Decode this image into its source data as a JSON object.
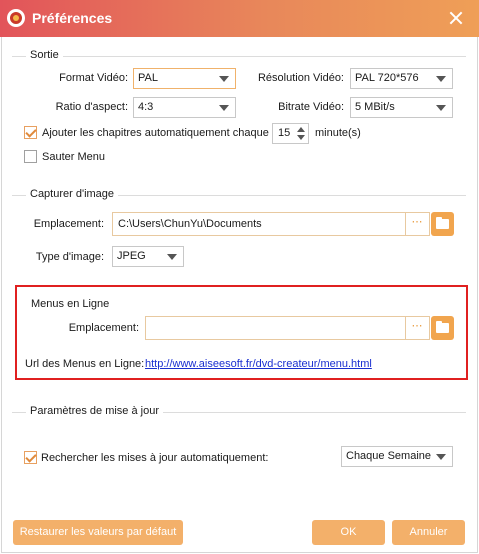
{
  "window": {
    "title": "Préférences"
  },
  "sortie": {
    "group_title": "Sortie",
    "format_video_label": "Format Vidéo:",
    "format_video_value": "PAL",
    "resolution_label": "Résolution Vidéo:",
    "resolution_value": "PAL 720*576",
    "ratio_label": "Ratio d'aspect:",
    "ratio_value": "4:3",
    "bitrate_label": "Bitrate Vidéo:",
    "bitrate_value": "5 MBit/s",
    "chapters_label": "Ajouter les chapitres automatiquement chaque",
    "chapters_checked": true,
    "chapters_value": "15",
    "chapters_unit": "minute(s)",
    "skip_menu_label": "Sauter Menu",
    "skip_menu_checked": false
  },
  "capture": {
    "group_title": "Capturer d'image",
    "location_label": "Emplacement:",
    "location_value": "C:\\Users\\ChunYu\\Documents",
    "image_type_label": "Type d'image:",
    "image_type_value": "JPEG"
  },
  "online_menus": {
    "group_title": "Menus en Ligne",
    "location_label": "Emplacement:",
    "location_value": "",
    "url_label": "Url des Menus en Ligne:",
    "url_value": "http://www.aiseesoft.fr/dvd-createur/menu.html"
  },
  "updates": {
    "group_title": "Paramètres de mise à jour",
    "auto_check_label": "Rechercher les mises à jour automatiquement:",
    "auto_check_checked": true,
    "frequency_value": "Chaque Semaine"
  },
  "footer": {
    "restore_label": "Restaurer les valeurs par défaut",
    "ok_label": "OK",
    "cancel_label": "Annuler"
  },
  "icons": {
    "dots": "⋯",
    "browse_folder": "folder-icon"
  },
  "colors": {
    "accent": "#f3b06a",
    "title_gradient_start": "#e2545a",
    "title_gradient_end": "#ef9f57",
    "highlight": "#e02020",
    "link": "#1a2fd0"
  }
}
